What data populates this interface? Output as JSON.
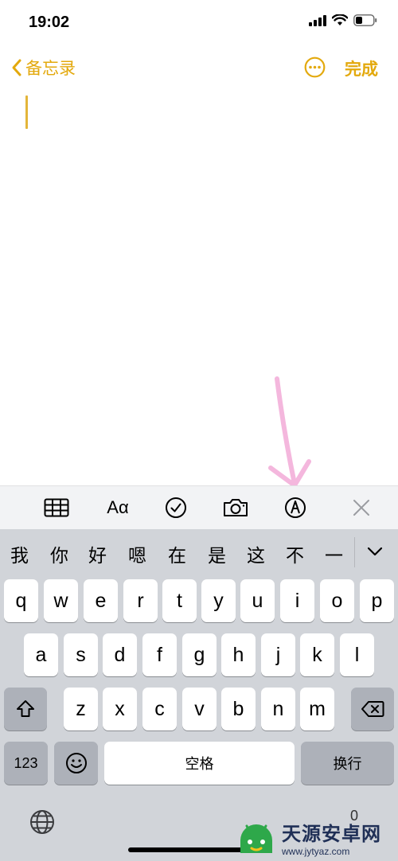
{
  "status_bar": {
    "time": "19:02"
  },
  "nav": {
    "back_label": "备忘录",
    "done_label": "完成"
  },
  "colors": {
    "accent": "#e3a90d",
    "annotation_arrow": "#f4b7dd",
    "keyboard_bg": "#d1d4d9",
    "toolbar_bg": "#f2f3f5"
  },
  "toolbar": {
    "icons": [
      "table-icon",
      "text-format-icon",
      "checklist-icon",
      "camera-icon",
      "markup-icon",
      "close-icon"
    ],
    "format_label": "Aα"
  },
  "candidates": [
    "我",
    "你",
    "好",
    "嗯",
    "在",
    "是",
    "这",
    "不",
    "一"
  ],
  "keyboard": {
    "row1": [
      "q",
      "w",
      "e",
      "r",
      "t",
      "y",
      "u",
      "i",
      "o",
      "p"
    ],
    "row2": [
      "a",
      "s",
      "d",
      "f",
      "g",
      "h",
      "j",
      "k",
      "l"
    ],
    "row3": [
      "z",
      "x",
      "c",
      "v",
      "b",
      "n",
      "m"
    ],
    "numbers_label": "123",
    "space_label": "空格",
    "return_label": "换行",
    "dictation_hint": "0"
  },
  "watermark": {
    "name": "天源安卓网",
    "url": "www.jytyaz.com"
  }
}
